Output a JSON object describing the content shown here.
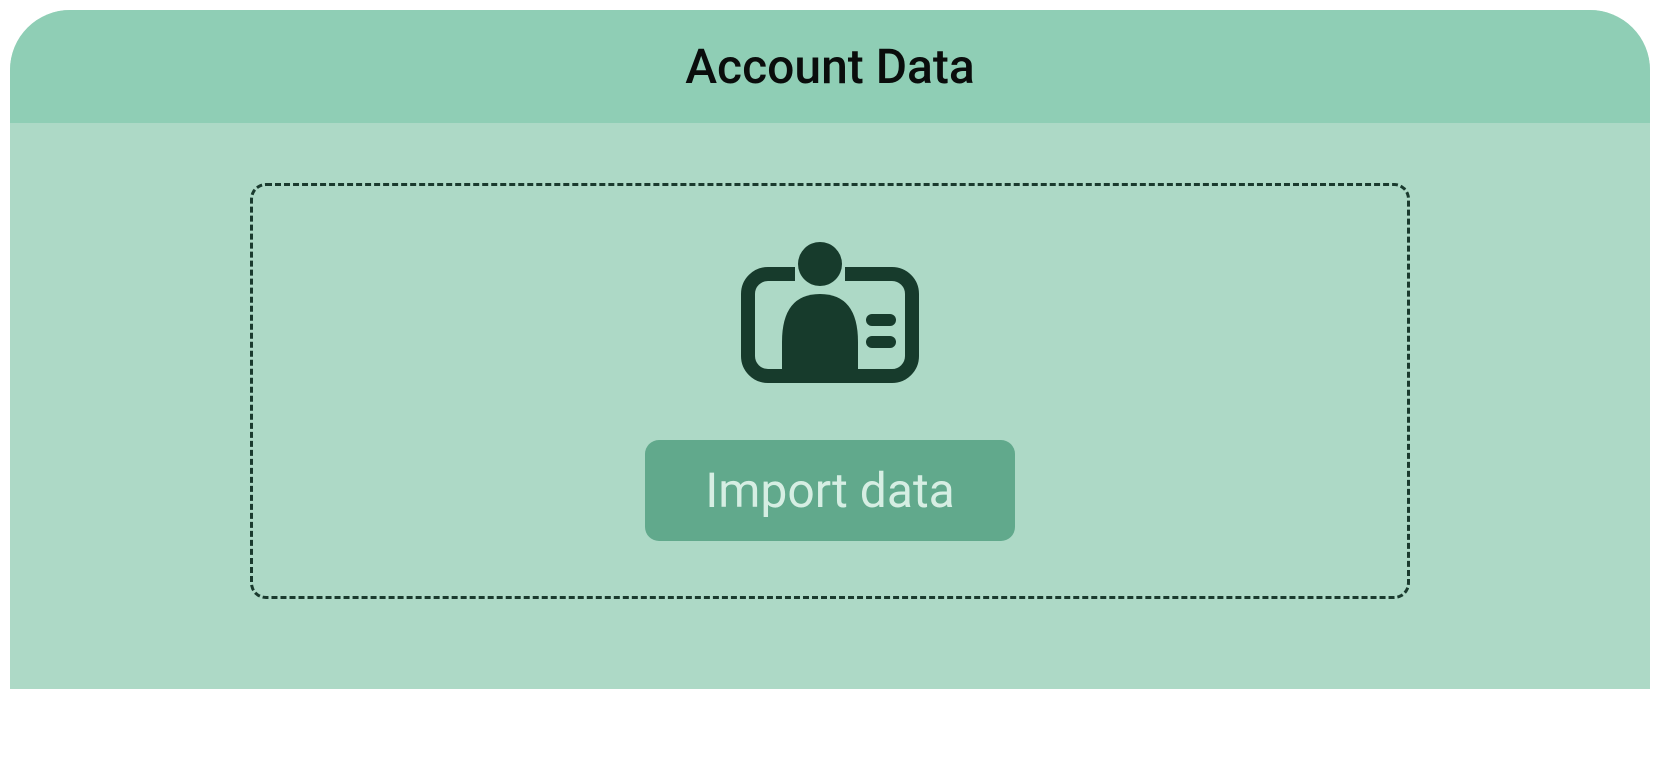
{
  "panel": {
    "title": "Account Data"
  },
  "dropzone": {
    "icon": "id-card-icon",
    "button_label": "Import data"
  },
  "colors": {
    "header_bg": "#8fceb5",
    "body_bg": "#add9c6",
    "dash_border": "#1a3a2e",
    "button_bg": "#61a98c",
    "button_text": "#d6eee3",
    "title_text": "#0a0d0c",
    "icon_stroke": "#173b2c",
    "icon_fill": "#173b2c"
  }
}
